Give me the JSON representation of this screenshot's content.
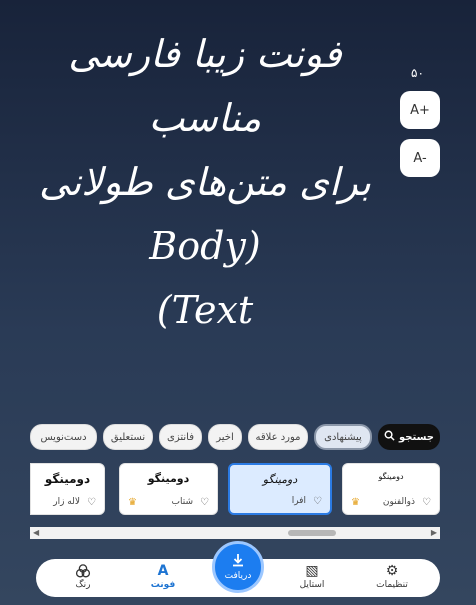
{
  "preview": {
    "line1": "فونت زیبا فارسی مناسب",
    "line2": "برای متن‌های طولانی (Body",
    "line3": "Text)"
  },
  "font_size": {
    "value": "۵۰",
    "increase_label": "A+",
    "decrease_label": "A-"
  },
  "filters": [
    {
      "label": "جستجو",
      "icon": "search-icon"
    },
    {
      "label": "پیشنهادی",
      "selected": true
    },
    {
      "label": "مورد علاقه"
    },
    {
      "label": "اخیر"
    },
    {
      "label": "فانتزی"
    },
    {
      "label": "نستعلیق"
    },
    {
      "label": "دست‌نویس"
    }
  ],
  "fonts": [
    {
      "sample": "دومینگو",
      "name": "ذوالفنون",
      "premium": true,
      "favorite": false
    },
    {
      "sample": "دومینگو",
      "name": "افرا",
      "selected": true,
      "premium": false,
      "favorite": false
    },
    {
      "sample": "دومینگو",
      "name": "شتاب",
      "premium": true,
      "favorite": false
    },
    {
      "sample": "دومینگو",
      "name": "لاله زار",
      "premium": false,
      "favorite": false
    }
  ],
  "bottom_nav": {
    "settings": "تنظیمات",
    "style": "استایل",
    "download": "دریافت",
    "font": "فونت",
    "color": "رنگ"
  },
  "colors": {
    "accent": "#1c7df0",
    "background_top": "#18233a",
    "background_bottom": "#34465f"
  }
}
